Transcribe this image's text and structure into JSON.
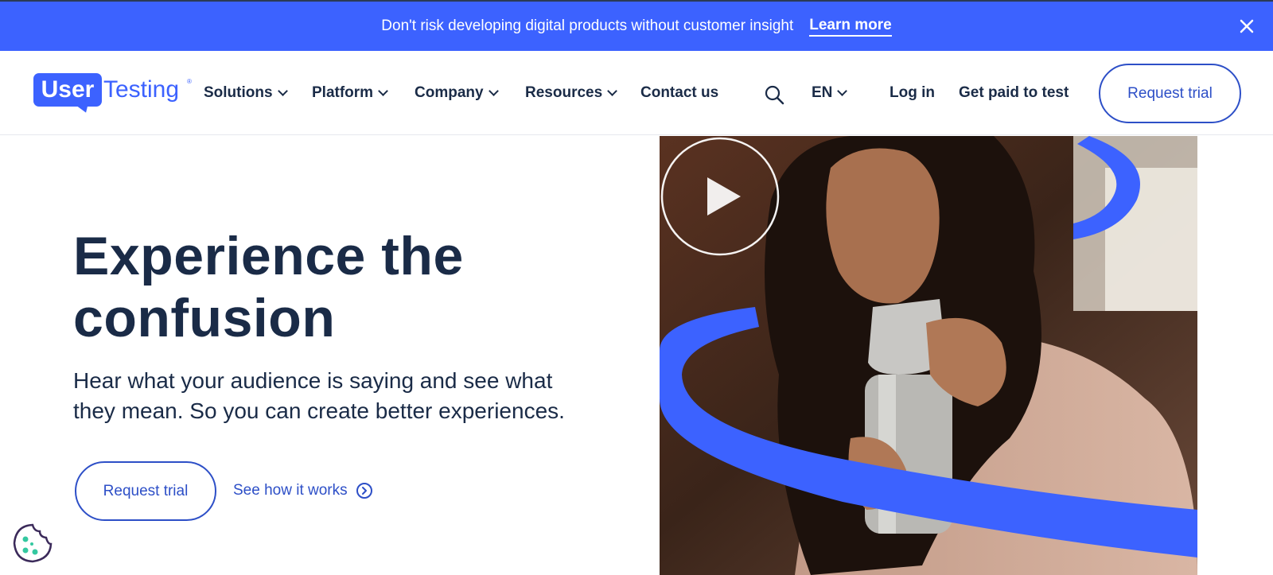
{
  "banner": {
    "text": "Don't risk developing digital products without customer insight",
    "link_label": "Learn more",
    "close_icon": "close-icon"
  },
  "header": {
    "logo": {
      "part1": "User",
      "part2": "Testing",
      "reg": "®"
    },
    "nav": [
      {
        "label": "Solutions",
        "dropdown": true
      },
      {
        "label": "Platform",
        "dropdown": true
      },
      {
        "label": "Company",
        "dropdown": true
      },
      {
        "label": "Resources",
        "dropdown": true
      },
      {
        "label": "Contact us",
        "dropdown": false
      }
    ],
    "search_icon": "search-icon",
    "language": "EN",
    "login": "Log in",
    "get_paid": "Get paid to test",
    "request_trial": "Request trial"
  },
  "hero": {
    "title_line1": "Experience the",
    "title_line2": "confusion",
    "subtitle_line1": "Hear what your audience is saying and see what",
    "subtitle_line2": "they mean. So you can create better experiences.",
    "primary_button": "Request trial",
    "secondary_link": "See how it works"
  },
  "media": {
    "play_icon": "play-icon"
  },
  "cookie": {
    "icon": "cookie-icon"
  },
  "colors": {
    "brand_blue": "#3c62ff",
    "link_blue": "#2d4fc7",
    "text_navy": "#1a2b47"
  }
}
